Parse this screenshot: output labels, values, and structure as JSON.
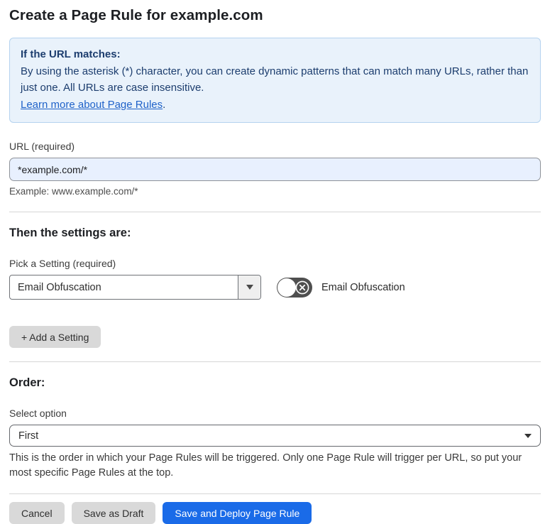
{
  "page": {
    "title": "Create a Page Rule for example.com"
  },
  "info_box": {
    "heading": "If the URL matches:",
    "body": "By using the asterisk (*) character, you can create dynamic patterns that can match many URLs, rather than just one. All URLs are case insensitive.",
    "link_text": "Learn more about Page Rules",
    "link_suffix": "."
  },
  "url_field": {
    "label": "URL (required)",
    "value": "*example.com/*",
    "example": "Example: www.example.com/*"
  },
  "settings_section": {
    "heading": "Then the settings are:",
    "picker_label": "Pick a Setting (required)",
    "picker_value": "Email Obfuscation",
    "toggle_label": "Email Obfuscation",
    "toggle_state": "off",
    "add_setting_label": "+ Add a Setting"
  },
  "order_section": {
    "heading": "Order:",
    "select_label": "Select option",
    "select_value": "First",
    "help": "This is the order in which your Page Rules will be triggered. Only one Page Rule will trigger per URL, so put your most specific Page Rules at the top."
  },
  "footer": {
    "cancel_label": "Cancel",
    "save_draft_label": "Save as Draft",
    "deploy_label": "Save and Deploy Page Rule"
  },
  "colors": {
    "info_bg": "#e9f2fb",
    "info_border": "#b5d3ef",
    "info_text": "#1c3d6e",
    "link_blue": "#1f62c9",
    "input_autofill_bg": "#e8f0fe",
    "primary_button_blue": "#1a6be8",
    "gray_button": "#d9d9d9",
    "toggle_off_bg": "#4f4f4f"
  }
}
